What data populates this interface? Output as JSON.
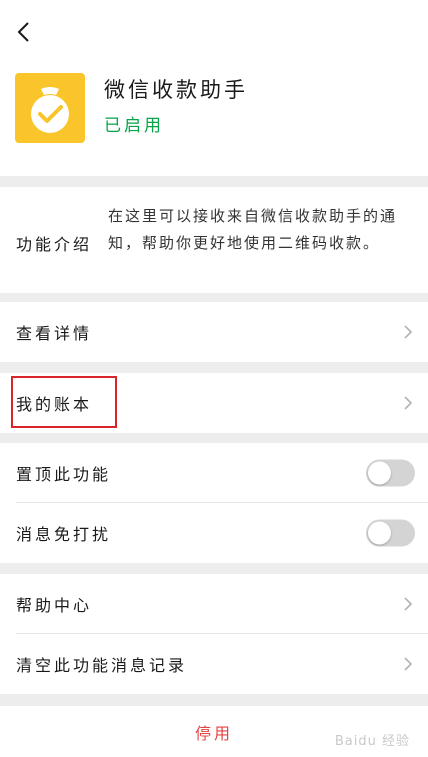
{
  "header": {
    "app_name": "微信收款助手",
    "status": "已启用",
    "back_icon": "chevron-left-icon",
    "app_icon": "money-bag-check-icon",
    "app_icon_color": "#f9c52b",
    "status_color": "#07a44b"
  },
  "intro": {
    "label": "功能介绍",
    "text": "在这里可以接收来自微信收款助手的通知，帮助你更好地使用二维码收款。"
  },
  "rows": {
    "view_details": "查看详情",
    "my_ledger": "我的账本",
    "pin_feature": "置顶此功能",
    "mute_messages": "消息免打扰",
    "help_center": "帮助中心",
    "clear_history": "清空此功能消息记录"
  },
  "toggles": {
    "pin_feature_on": false,
    "mute_messages_on": false
  },
  "footer": {
    "disable": "停用",
    "disable_color": "#e64340"
  },
  "watermark": {
    "text": "Baidu 经验"
  }
}
